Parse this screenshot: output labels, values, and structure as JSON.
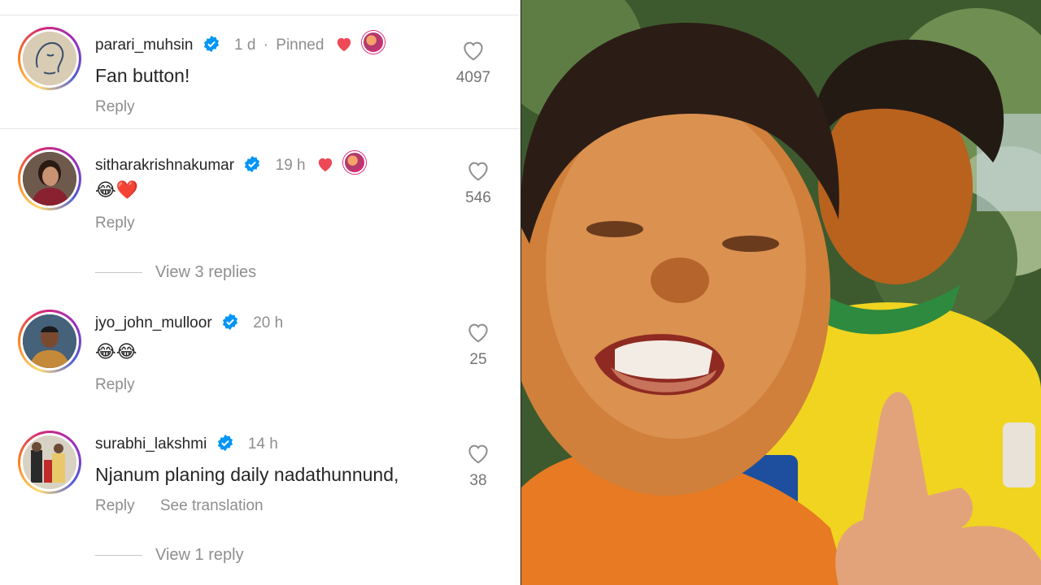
{
  "comments": [
    {
      "username": "parari_muhsin",
      "time": "1 d",
      "dot": "·",
      "pinned": "Pinned",
      "text": "Fan button!",
      "reply": "Reply",
      "likes": "4097"
    },
    {
      "username": "sitharakrishnakumar",
      "time": "19 h",
      "text": "😂❤️",
      "reply": "Reply",
      "likes": "546",
      "view_replies": "View 3 replies"
    },
    {
      "username": "jyo_john_mulloor",
      "time": "20 h",
      "text": "😂😂",
      "reply": "Reply",
      "likes": "25"
    },
    {
      "username": "surabhi_lakshmi",
      "time": "14 h",
      "text": "Njanum planing daily nadathunnund,",
      "reply": "Reply",
      "see_translation": "See translation",
      "likes": "38",
      "view_replies": "View 1 reply"
    }
  ],
  "colors": {
    "verified": "#0095f6",
    "heart_red": "#ed4956",
    "muted_text": "#8e8e8e"
  },
  "icons": [
    "verified-badge-icon",
    "heart-outline-icon",
    "heart-filled-icon",
    "creator-avatar-icon"
  ]
}
